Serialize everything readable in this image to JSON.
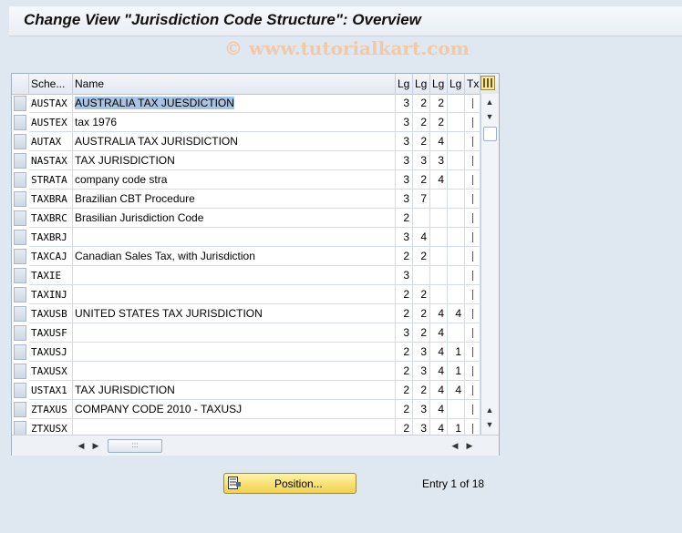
{
  "page": {
    "title": "Change View \"Jurisdiction Code Structure\": Overview",
    "watermark": "© www.tutorialkart.com"
  },
  "table": {
    "headers": {
      "scheme": "Sche...",
      "name": "Name",
      "lg1": "Lg",
      "lg2": "Lg",
      "lg3": "Lg",
      "lg4": "Lg",
      "tx": "Tx"
    },
    "rows": [
      {
        "scheme": "AUSTAX",
        "name": "AUSTRALIA TAX JUESDICTION",
        "l1": "3",
        "l2": "2",
        "l3": "2",
        "l4": ""
      },
      {
        "scheme": "AUSTEX",
        "name": "tax 1976",
        "l1": "3",
        "l2": "2",
        "l3": "2",
        "l4": ""
      },
      {
        "scheme": "AUTAX",
        "name": "AUSTRALIA TAX JURISDICTION",
        "l1": "3",
        "l2": "2",
        "l3": "4",
        "l4": ""
      },
      {
        "scheme": "NASTAX",
        "name": "TAX JURISDICTION",
        "l1": "3",
        "l2": "3",
        "l3": "3",
        "l4": ""
      },
      {
        "scheme": "STRATA",
        "name": "company code stra",
        "l1": "3",
        "l2": "2",
        "l3": "4",
        "l4": ""
      },
      {
        "scheme": "TAXBRA",
        "name": "Brazilian CBT Procedure",
        "l1": "3",
        "l2": "7",
        "l3": "",
        "l4": ""
      },
      {
        "scheme": "TAXBRC",
        "name": "Brasilian Jurisdiction Code",
        "l1": "2",
        "l2": "",
        "l3": "",
        "l4": ""
      },
      {
        "scheme": "TAXBRJ",
        "name": "",
        "l1": "3",
        "l2": "4",
        "l3": "",
        "l4": ""
      },
      {
        "scheme": "TAXCAJ",
        "name": "Canadian Sales Tax, with Jurisdiction",
        "l1": "2",
        "l2": "2",
        "l3": "",
        "l4": ""
      },
      {
        "scheme": "TAXIE",
        "name": "",
        "l1": "3",
        "l2": "",
        "l3": "",
        "l4": ""
      },
      {
        "scheme": "TAXINJ",
        "name": "",
        "l1": "2",
        "l2": "2",
        "l3": "",
        "l4": ""
      },
      {
        "scheme": "TAXUSB",
        "name": "UNITED STATES TAX JURISDICTION",
        "l1": "2",
        "l2": "2",
        "l3": "4",
        "l4": "4"
      },
      {
        "scheme": "TAXUSF",
        "name": "",
        "l1": "3",
        "l2": "2",
        "l3": "4",
        "l4": ""
      },
      {
        "scheme": "TAXUSJ",
        "name": "",
        "l1": "2",
        "l2": "3",
        "l3": "4",
        "l4": "1"
      },
      {
        "scheme": "TAXUSX",
        "name": "",
        "l1": "2",
        "l2": "3",
        "l3": "4",
        "l4": "1"
      },
      {
        "scheme": "USTAX1",
        "name": "TAX JURISDICTION",
        "l1": "2",
        "l2": "2",
        "l3": "4",
        "l4": "4"
      },
      {
        "scheme": "ZTAXUS",
        "name": "COMPANY CODE 2010 - TAXUSJ",
        "l1": "2",
        "l2": "3",
        "l3": "4",
        "l4": ""
      },
      {
        "scheme": "ZTXUSX",
        "name": "",
        "l1": "2",
        "l2": "3",
        "l3": "4",
        "l4": "1"
      }
    ]
  },
  "footer": {
    "position_label": "Position...",
    "entry_info": "Entry 1 of 18"
  }
}
